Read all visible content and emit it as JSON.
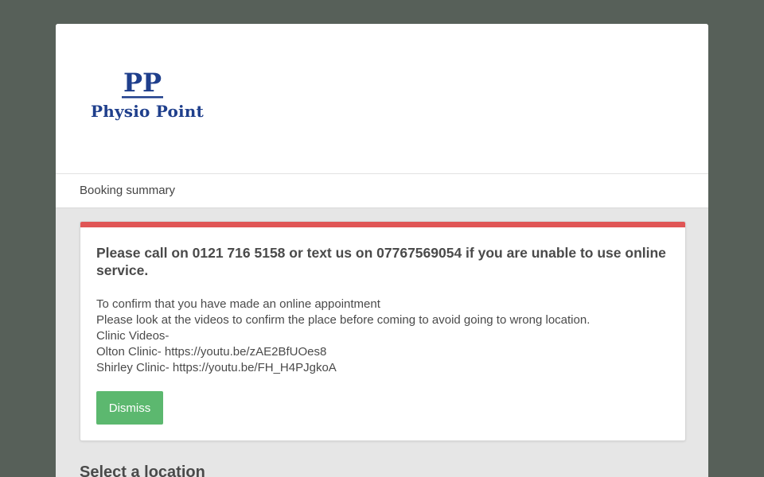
{
  "brand": {
    "logo_initials": "PP",
    "logo_text": "Physio Point",
    "color": "#1f3f8c"
  },
  "nav": {
    "label": "Booking summary"
  },
  "alert": {
    "accent_color": "#e05555",
    "title": "Please call on 0121 716 5158 or text us on 07767569054 if you are unable to use online service.",
    "lines": [
      "To confirm that you have made an online appointment",
      "Please look at the videos to confirm the place before coming to avoid going to wrong location.",
      "Clinic Videos-",
      "Olton Clinic- https://youtu.be/zAE2BfUOes8",
      "Shirley Clinic- https://youtu.be/FH_H4PJgkoA"
    ],
    "dismiss_label": "Dismiss",
    "dismiss_color": "#5cb86f"
  },
  "section": {
    "title": "Select a location"
  }
}
